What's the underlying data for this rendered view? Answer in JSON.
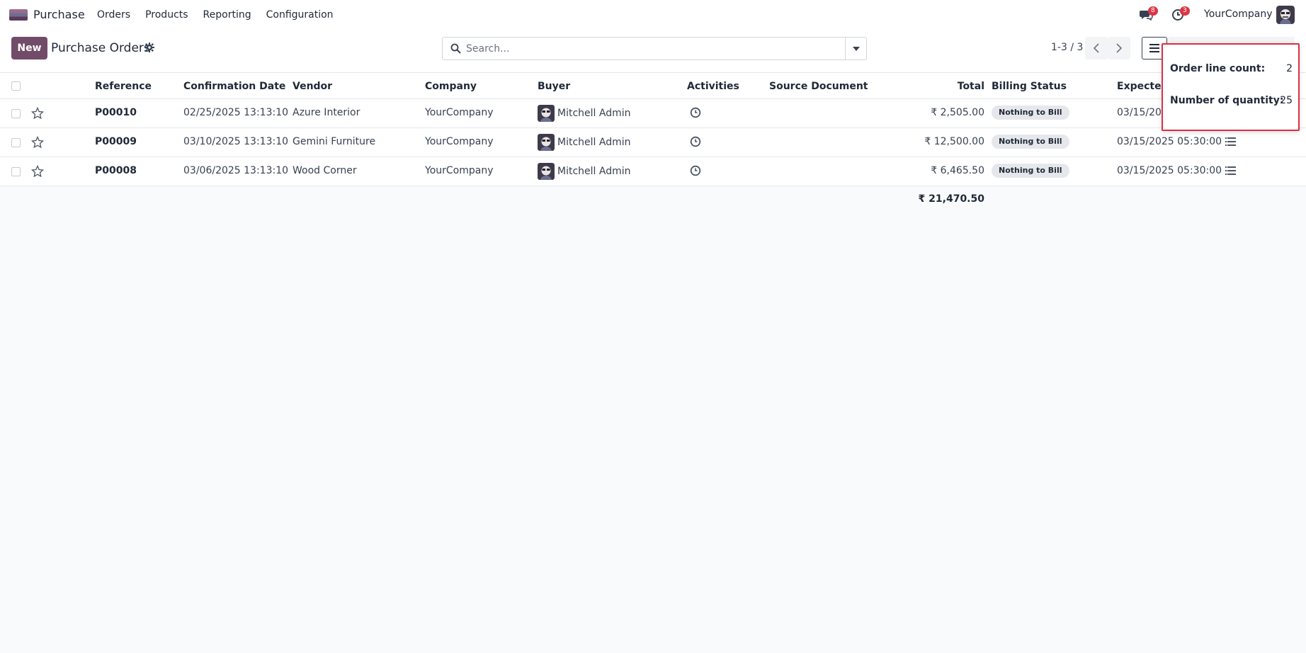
{
  "navbar": {
    "app_name": "Purchase",
    "menu": [
      "Orders",
      "Products",
      "Reporting",
      "Configuration"
    ],
    "messages_badge": "8",
    "activities_badge": "3",
    "company": "YourCompany"
  },
  "control_panel": {
    "new_label": "New",
    "title": "Purchase Orders",
    "search_placeholder": "Search...",
    "pager": "1-3 / 3"
  },
  "table": {
    "headers": {
      "reference": "Reference",
      "confirmation_date": "Confirmation Date",
      "vendor": "Vendor",
      "company": "Company",
      "buyer": "Buyer",
      "activities": "Activities",
      "source_document": "Source Document",
      "total": "Total",
      "billing_status": "Billing Status",
      "expected_arrival": "Expected A"
    },
    "rows": [
      {
        "reference": "P00010",
        "confirmation_date": "02/25/2025 13:13:10",
        "vendor": "Azure Interior",
        "company": "YourCompany",
        "buyer": "Mitchell Admin",
        "total": "₹ 2,505.00",
        "billing_status": "Nothing to Bill",
        "expected_arrival": "03/15/2025"
      },
      {
        "reference": "P00009",
        "confirmation_date": "03/10/2025 13:13:10",
        "vendor": "Gemini Furniture",
        "company": "YourCompany",
        "buyer": "Mitchell Admin",
        "total": "₹ 12,500.00",
        "billing_status": "Nothing to Bill",
        "expected_arrival": "03/15/2025 05:30:00"
      },
      {
        "reference": "P00008",
        "confirmation_date": "03/06/2025 13:13:10",
        "vendor": "Wood Corner",
        "company": "YourCompany",
        "buyer": "Mitchell Admin",
        "total": "₹ 6,465.50",
        "billing_status": "Nothing to Bill",
        "expected_arrival": "03/15/2025 05:30:00"
      }
    ],
    "total_sum": "₹ 21,470.50"
  },
  "popover": {
    "line_count_label": "Order line count:",
    "line_count_value": "2",
    "quantity_label": "Number of quantity:",
    "quantity_value": "25"
  },
  "colors": {
    "brand": "#714b67",
    "badge": "#dc3545",
    "highlight": "#dc2e45"
  }
}
